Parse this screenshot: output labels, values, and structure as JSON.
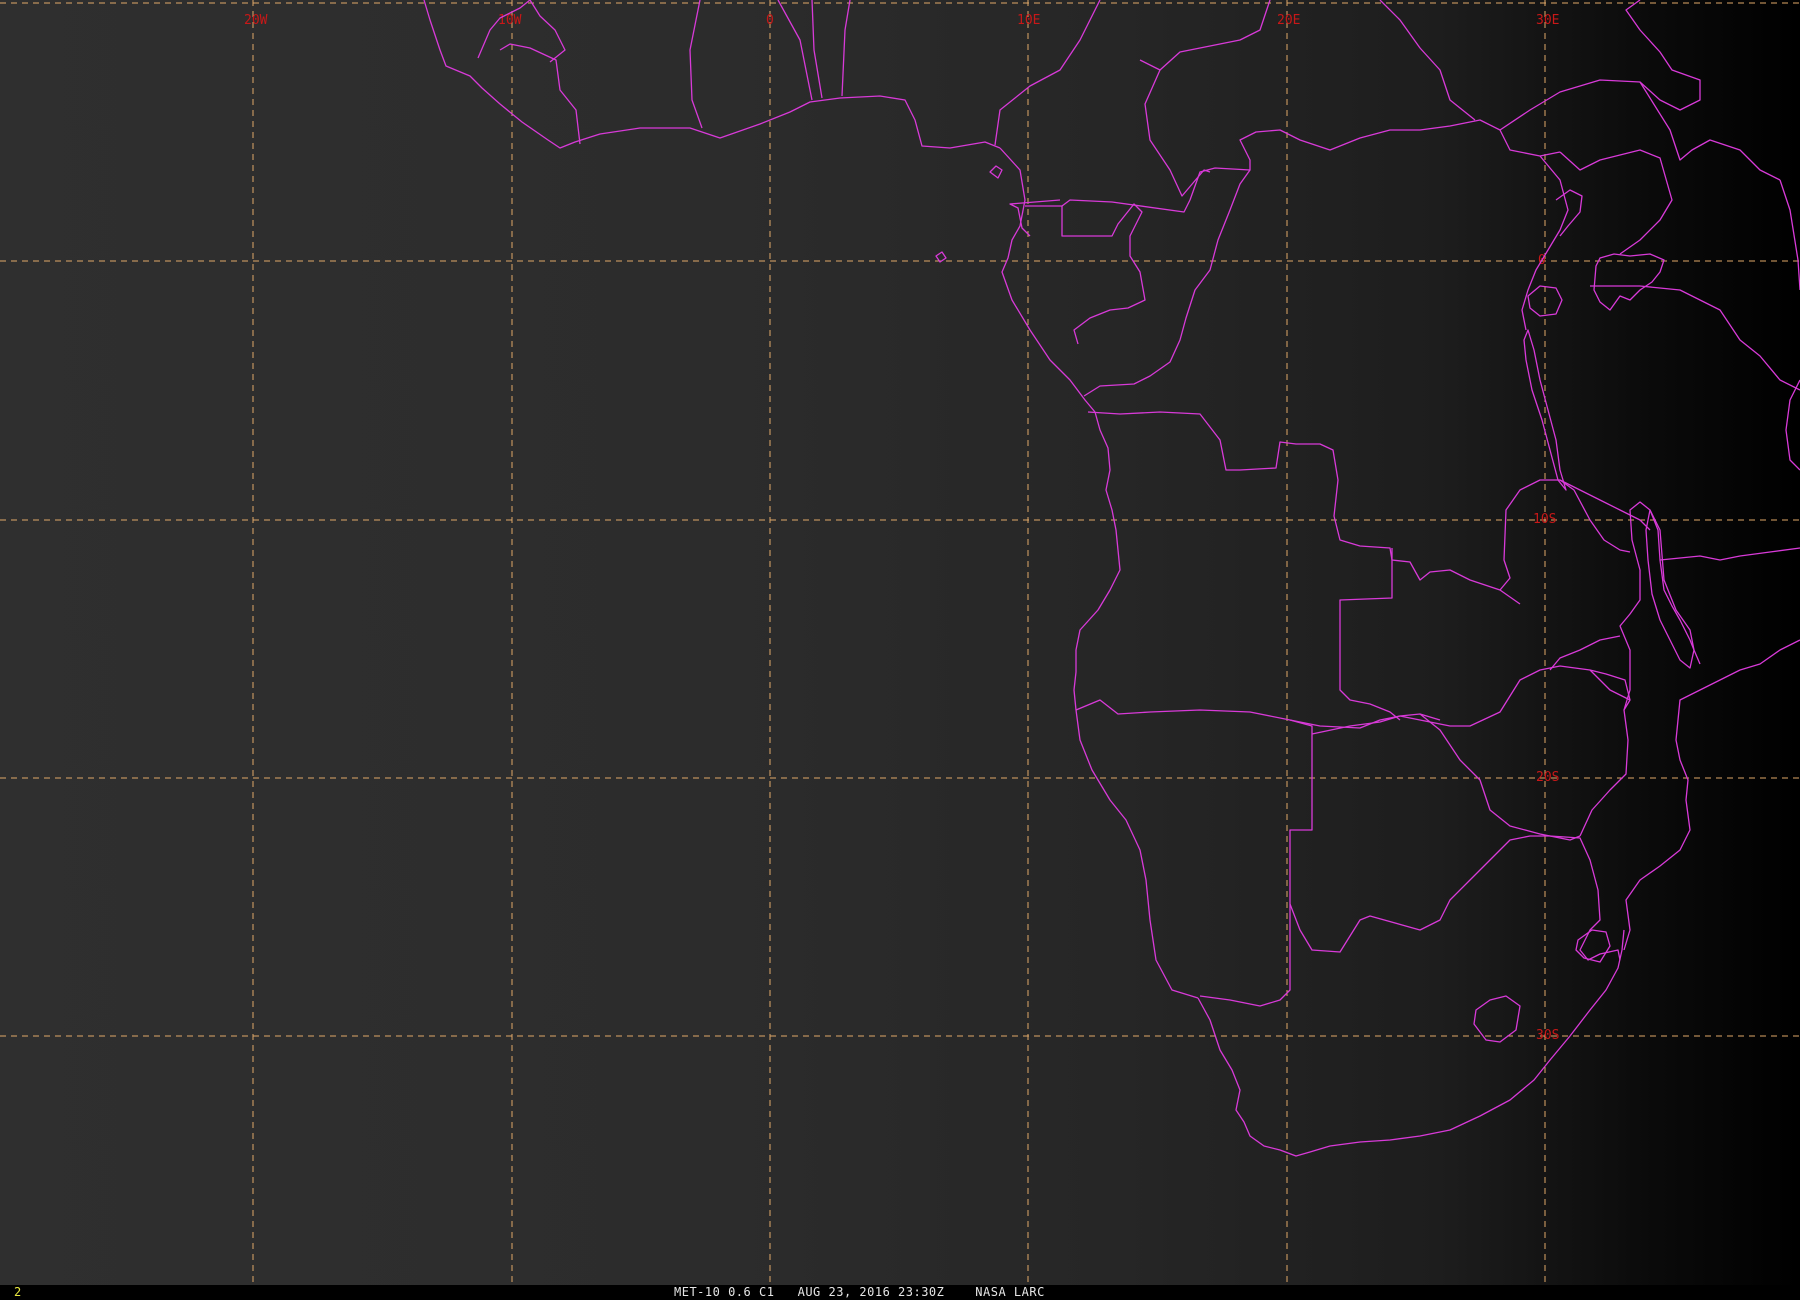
{
  "map": {
    "longitude_labels": [
      "20W",
      "10W",
      "0",
      "10E",
      "20E",
      "30E"
    ],
    "latitude_labels": [
      "0",
      "10S",
      "20S",
      "30S"
    ],
    "colors": {
      "grid": "#e0a868",
      "borders": "#d83ad8",
      "grid_labels": "#c81818"
    }
  },
  "status": {
    "frame": "2",
    "satellite": "MET-10 0.6 C1",
    "datetime": "AUG 23, 2016 23:30Z",
    "source": "NASA LARC"
  }
}
